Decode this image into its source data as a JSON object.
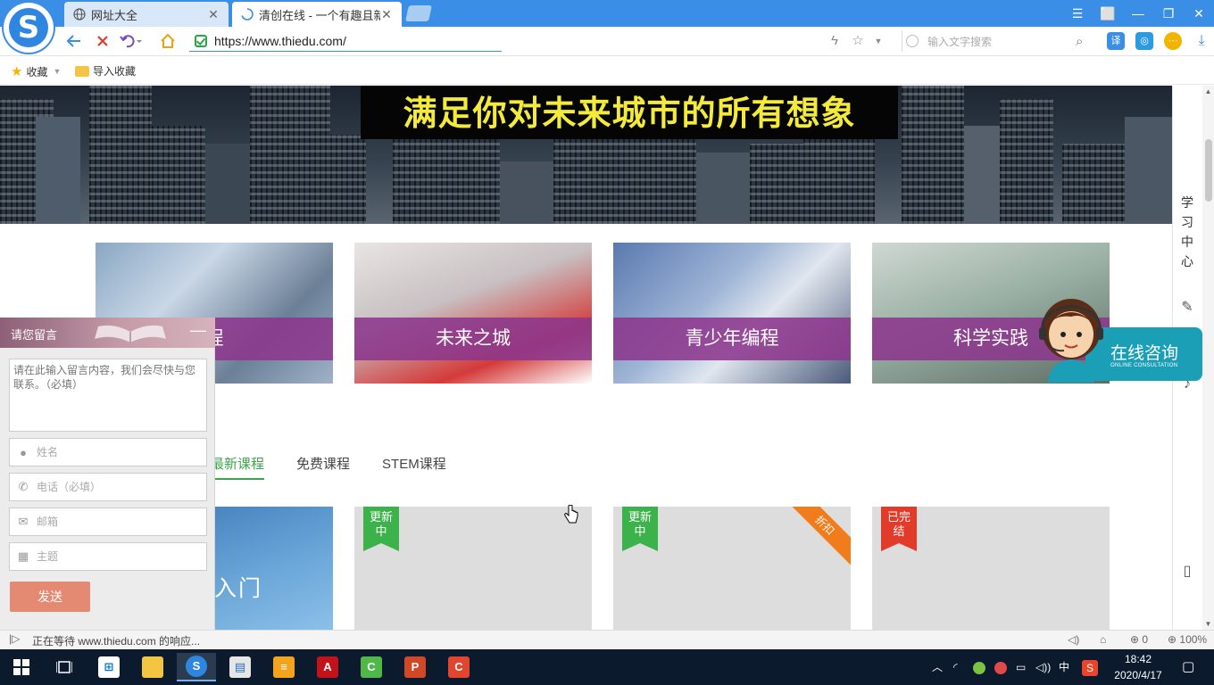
{
  "browser": {
    "tabs": [
      {
        "title": "网址大全",
        "close": "✕"
      },
      {
        "title": "清创在线 - 一个有趣且新",
        "close": "✕"
      }
    ],
    "window_controls": [
      "☰",
      "⬜",
      "—",
      "❐",
      "✕"
    ],
    "url": "https://www.thiedu.com/",
    "search_placeholder": "输入文字搜索",
    "bookmarks": {
      "favorites": "收藏",
      "import": "导入收藏"
    }
  },
  "page": {
    "banner_title": "满足你对未来城市的所有想象",
    "categories": [
      {
        "label": "程"
      },
      {
        "label": "未来之城"
      },
      {
        "label": "青少年编程"
      },
      {
        "label": "科学实践"
      }
    ],
    "course_tabs": [
      {
        "label": "最新课程",
        "active": true
      },
      {
        "label": "免费课程",
        "active": false
      },
      {
        "label": "STEM课程",
        "active": false
      }
    ],
    "courses": [
      {
        "title": "设计入门",
        "ribbon": "",
        "ribbon_color": ""
      },
      {
        "title": "",
        "ribbon": "更新中",
        "ribbon_color": "#3cb34a"
      },
      {
        "title": "",
        "ribbon": "更新中",
        "ribbon_color": "#3cb34a",
        "badge": "折扣"
      },
      {
        "title": "",
        "ribbon": "已完结",
        "ribbon_color": "#e23b2a"
      }
    ],
    "side_panel": {
      "study_center": "学习中心"
    },
    "consult": {
      "title": "在线咨询",
      "subtitle": "ONLINE CONSULTATION"
    }
  },
  "message_form": {
    "title": "请您留言",
    "minimize": "—",
    "message_placeholder": "请在此输入留言内容，我们会尽快与您联系。（必填）",
    "name_placeholder": "姓名",
    "phone_placeholder": "电话（必填）",
    "email_placeholder": "邮箱",
    "subject_placeholder": "主题",
    "send_label": "发送"
  },
  "status": {
    "text": "正在等待 www.thiedu.com 的响应...",
    "download_count": "0",
    "zoom": "100%"
  },
  "taskbar": {
    "time": "18:42",
    "date": "2020/4/17",
    "ime": "中"
  },
  "colors": {
    "accent_blue": "#3a8ee6",
    "active_tab_green": "#3fa34d",
    "category_strip": "#8c378c",
    "send_button": "#e58a72",
    "consult": "#1a9fb7"
  }
}
